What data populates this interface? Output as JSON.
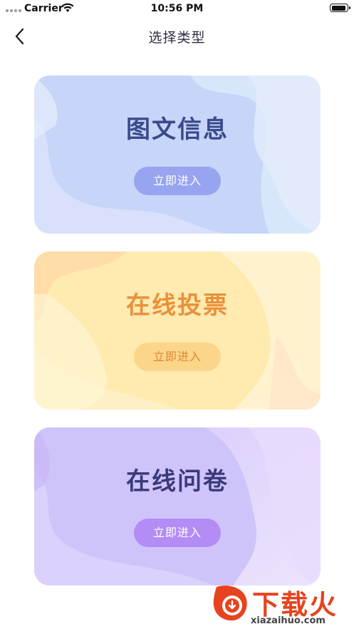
{
  "status_bar": {
    "carrier": "Carrier",
    "time": "10:56 PM"
  },
  "nav": {
    "title": "选择类型"
  },
  "cards": [
    {
      "title": "图文信息",
      "button": "立即进入"
    },
    {
      "title": "在线投票",
      "button": "立即进入"
    },
    {
      "title": "在线问卷",
      "button": "立即进入"
    }
  ],
  "watermark": {
    "text": "下载火",
    "url": "xiazaihuo.com"
  },
  "colors": {
    "card1_accent": "#97a4ef",
    "card2_accent": "#fbd58a",
    "card3_accent": "#b48cf5",
    "watermark": "#e6431e"
  }
}
